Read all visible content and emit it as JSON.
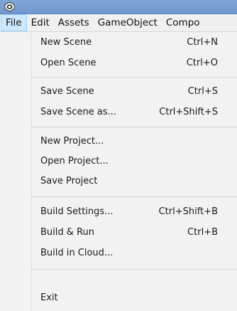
{
  "titlebar": {
    "icon": "unity-logo-icon"
  },
  "menubar": {
    "items": [
      {
        "label": "File"
      },
      {
        "label": "Edit"
      },
      {
        "label": "Assets"
      },
      {
        "label": "GameObject"
      },
      {
        "label": "Compo"
      }
    ]
  },
  "file_menu": {
    "items": [
      {
        "label": "New Scene",
        "shortcut": "Ctrl+N"
      },
      {
        "label": "Open Scene",
        "shortcut": "Ctrl+O"
      },
      {
        "label": "Save Scene",
        "shortcut": "Ctrl+S"
      },
      {
        "label": "Save Scene as...",
        "shortcut": "Ctrl+Shift+S"
      },
      {
        "label": "New Project..."
      },
      {
        "label": "Open Project..."
      },
      {
        "label": "Save Project"
      },
      {
        "label": "Build Settings...",
        "shortcut": "Ctrl+Shift+B"
      },
      {
        "label": "Build & Run",
        "shortcut": "Ctrl+B"
      },
      {
        "label": "Build in Cloud..."
      },
      {
        "label": "Exit"
      }
    ]
  }
}
